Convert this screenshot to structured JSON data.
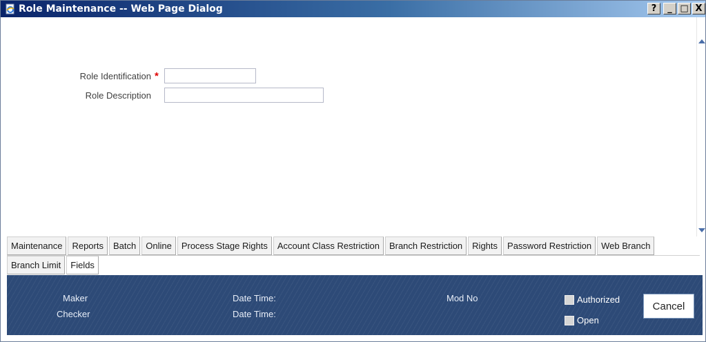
{
  "window": {
    "title": "Role Maintenance -- Web Page Dialog",
    "icon": "ie-page-icon",
    "controls": {
      "help": "?",
      "minimize": "_",
      "maximize": "□",
      "close": "X"
    }
  },
  "form": {
    "role_identification": {
      "label": "Role Identification",
      "required_marker": "*",
      "value": ""
    },
    "role_description": {
      "label": "Role Description",
      "value": ""
    }
  },
  "tabs": {
    "row1": [
      "Maintenance",
      "Reports",
      "Batch",
      "Online",
      "Process Stage Rights",
      "Account Class Restriction",
      "Branch Restriction",
      "Rights",
      "Password Restriction",
      "Web Branch"
    ],
    "row2": [
      "Branch Limit",
      "Fields"
    ],
    "active": "Fields"
  },
  "footer": {
    "maker_label": "Maker",
    "checker_label": "Checker",
    "maker_datetime_label": "Date Time:",
    "checker_datetime_label": "Date Time:",
    "mod_no_label": "Mod No",
    "authorized_label": "Authorized",
    "open_label": "Open",
    "cancel_label": "Cancel"
  },
  "colors": {
    "footer_bg": "#2d4a77",
    "titlebar_start": "#0a246a",
    "required": "#e00000"
  }
}
